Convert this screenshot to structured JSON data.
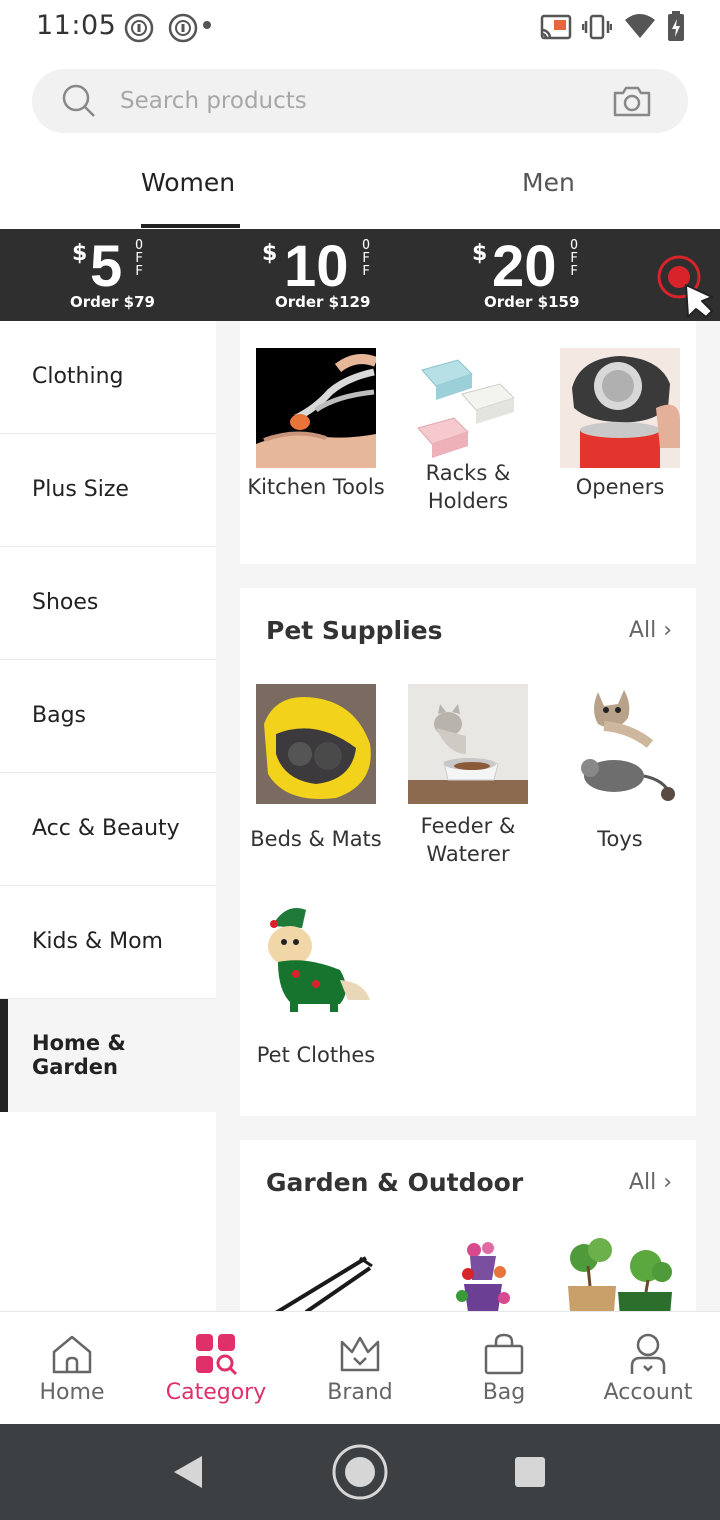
{
  "status_bar": {
    "time": "11:05"
  },
  "search": {
    "placeholder": "Search products"
  },
  "tabs": [
    {
      "label": "Women",
      "active": true
    },
    {
      "label": "Men",
      "active": false
    }
  ],
  "promo": {
    "coupons": [
      {
        "currency": "$",
        "amount": "5",
        "off": "OFF",
        "condition": "Order $79"
      },
      {
        "currency": "$",
        "amount": "10",
        "off": "OFF",
        "condition": "Order $129"
      },
      {
        "currency": "$",
        "amount": "20",
        "off": "OFF",
        "condition": "Order $159"
      }
    ],
    "colors": {
      "background": "#2f2f2f",
      "text": "#ffffff",
      "record_button": "#d8232a"
    }
  },
  "sidebar": {
    "items": [
      {
        "label": "Clothing",
        "active": false
      },
      {
        "label": "Plus Size",
        "active": false
      },
      {
        "label": "Shoes",
        "active": false
      },
      {
        "label": "Bags",
        "active": false
      },
      {
        "label": "Acc & Beauty",
        "active": false
      },
      {
        "label": "Kids & Mom",
        "active": false
      },
      {
        "label": "Home & Garden",
        "active": true
      }
    ]
  },
  "sections": {
    "kitchen": {
      "items": [
        {
          "label": "Kitchen Tools",
          "icon": "shrimp-peeler-image"
        },
        {
          "label": "Racks & Holders",
          "icon": "drawer-rack-image"
        },
        {
          "label": "Openers",
          "icon": "can-opener-image"
        }
      ]
    },
    "pet_supplies": {
      "title": "Pet Supplies",
      "all_label": "All",
      "items": [
        {
          "label": "Beds & Mats",
          "icon": "banana-bed-image"
        },
        {
          "label": "Feeder & Waterer",
          "icon": "cat-feeder-image"
        },
        {
          "label": "Toys",
          "icon": "mouse-toy-image"
        },
        {
          "label": "Pet Clothes",
          "icon": "dog-elf-costume-image"
        }
      ]
    },
    "garden": {
      "title": "Garden & Outdoor",
      "all_label": "All",
      "items": [
        {
          "icon": "garden-tool-image"
        },
        {
          "icon": "flower-tower-image"
        },
        {
          "icon": "grow-bag-image"
        }
      ]
    }
  },
  "bottom_nav": {
    "items": [
      {
        "label": "Home",
        "icon": "home-icon",
        "active": false
      },
      {
        "label": "Category",
        "icon": "category-icon",
        "active": true
      },
      {
        "label": "Brand",
        "icon": "crown-icon",
        "active": false
      },
      {
        "label": "Bag",
        "icon": "bag-icon",
        "active": false
      },
      {
        "label": "Account",
        "icon": "user-icon",
        "active": false
      }
    ],
    "colors": {
      "active": "#e0306a",
      "inactive": "#666666"
    }
  }
}
